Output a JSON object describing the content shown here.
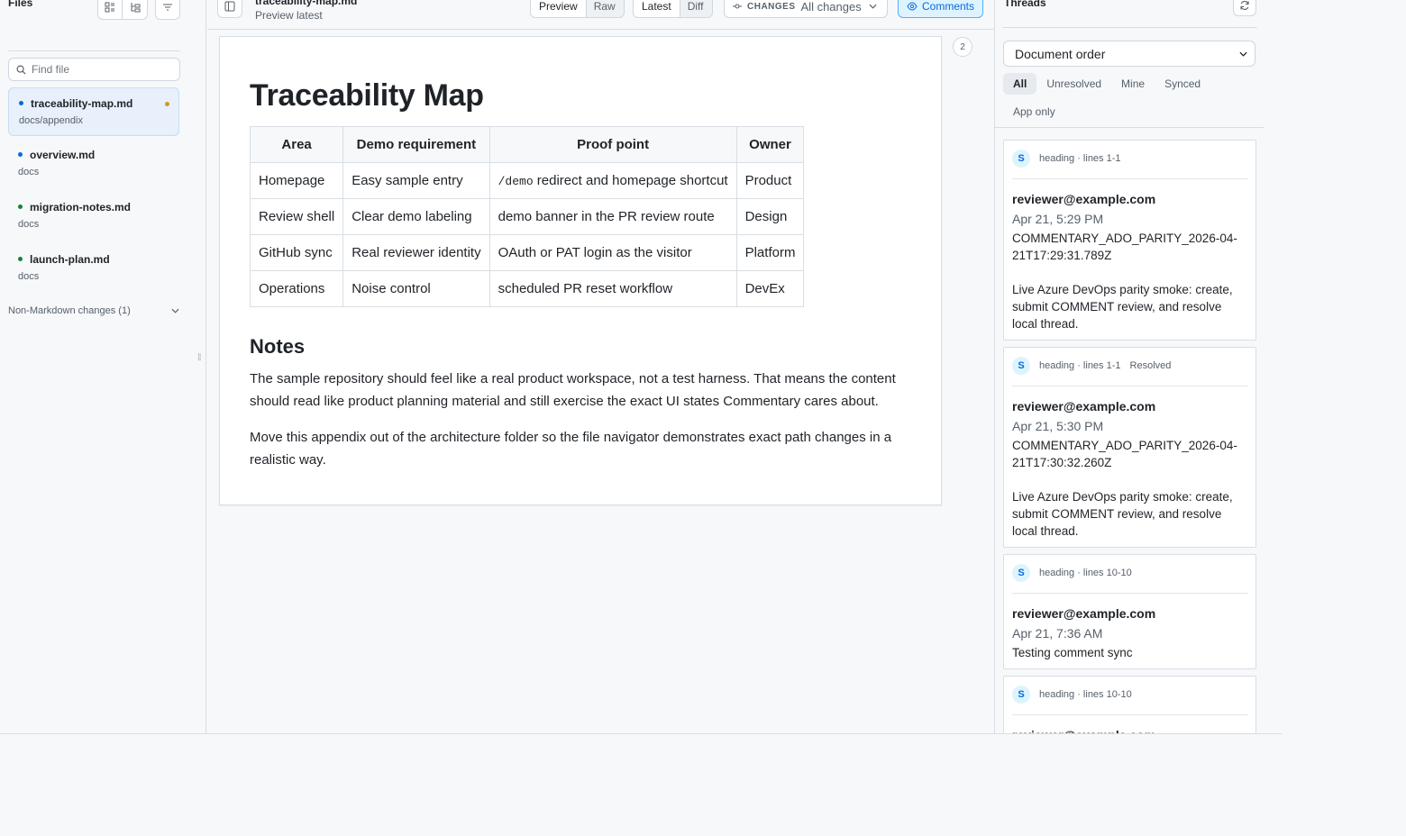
{
  "sidebar": {
    "title": "Files",
    "find_placeholder": "Find file",
    "files": [
      {
        "name": "traceability-map.md",
        "path": "docs/appendix",
        "dot_color": "#0969da",
        "active": true,
        "modified": true
      },
      {
        "name": "overview.md",
        "path": "docs",
        "dot_color": "#0969da",
        "active": false,
        "modified": false
      },
      {
        "name": "migration-notes.md",
        "path": "docs",
        "dot_color": "#1a7f37",
        "active": false,
        "modified": false
      },
      {
        "name": "launch-plan.md",
        "path": "docs",
        "dot_color": "#1a7f37",
        "active": false,
        "modified": false
      }
    ],
    "non_markdown": "Non-Markdown changes (1)"
  },
  "toolbar": {
    "doc_title": "traceability-map.md",
    "doc_subtitle": "Preview latest",
    "view_modes": [
      "Preview",
      "Raw"
    ],
    "view_selected": "Preview",
    "compare_modes": [
      "Latest",
      "Diff"
    ],
    "compare_selected": "Latest",
    "changes_label": "CHANGES",
    "changes_value": "All changes",
    "comments_label": "Comments"
  },
  "document": {
    "title": "Traceability Map",
    "table": {
      "headers": [
        "Area",
        "Demo requirement",
        "Proof point",
        "Owner"
      ],
      "rows": [
        [
          "Homepage",
          "Easy sample entry",
          "/demo| redirect and homepage shortcut",
          "Product"
        ],
        [
          "Review shell",
          "Clear demo labeling",
          "demo banner in the PR review route",
          "Design"
        ],
        [
          "GitHub sync",
          "Real reviewer identity",
          "OAuth or PAT login as the visitor",
          "Platform"
        ],
        [
          "Operations",
          "Noise control",
          "scheduled PR reset workflow",
          "DevEx"
        ]
      ]
    },
    "notes_heading": "Notes",
    "paragraphs": [
      "The sample repository should feel like a real product workspace, not a test harness. That means the content should read like product planning material and still exercise the exact UI states Commentary cares about.",
      "Move this appendix out of the architecture folder so the file navigator demonstrates exact path changes in a realistic way."
    ],
    "comment_count": "2"
  },
  "threads": {
    "title": "Threads",
    "order": "Document order",
    "filters": [
      "All",
      "Unresolved",
      "Mine",
      "Synced",
      "App only"
    ],
    "filter_selected": "All",
    "items": [
      {
        "avatar": "S",
        "anchor": "heading · lines 1-1",
        "status": "",
        "author": "reviewer@example.com",
        "time": "Apr 21, 5:29 PM",
        "body": "COMMENTARY_ADO_PARITY_2026-04-21T17:29:31.789Z\n\nLive Azure DevOps parity smoke: create, submit COMMENT review, and resolve local thread."
      },
      {
        "avatar": "S",
        "anchor": "heading · lines 1-1",
        "status": "Resolved",
        "author": "reviewer@example.com",
        "time": "Apr 21, 5:30 PM",
        "body": "COMMENTARY_ADO_PARITY_2026-04-21T17:30:32.260Z\n\nLive Azure DevOps parity smoke: create, submit COMMENT review, and resolve local thread."
      },
      {
        "avatar": "S",
        "anchor": "heading · lines 10-10",
        "status": "",
        "author": "reviewer@example.com",
        "time": "Apr 21, 7:36 AM",
        "body": "Testing comment sync"
      },
      {
        "avatar": "S",
        "anchor": "heading · lines 10-10",
        "status": "",
        "author": "reviewer@example.com",
        "time": "",
        "body": ""
      }
    ]
  }
}
